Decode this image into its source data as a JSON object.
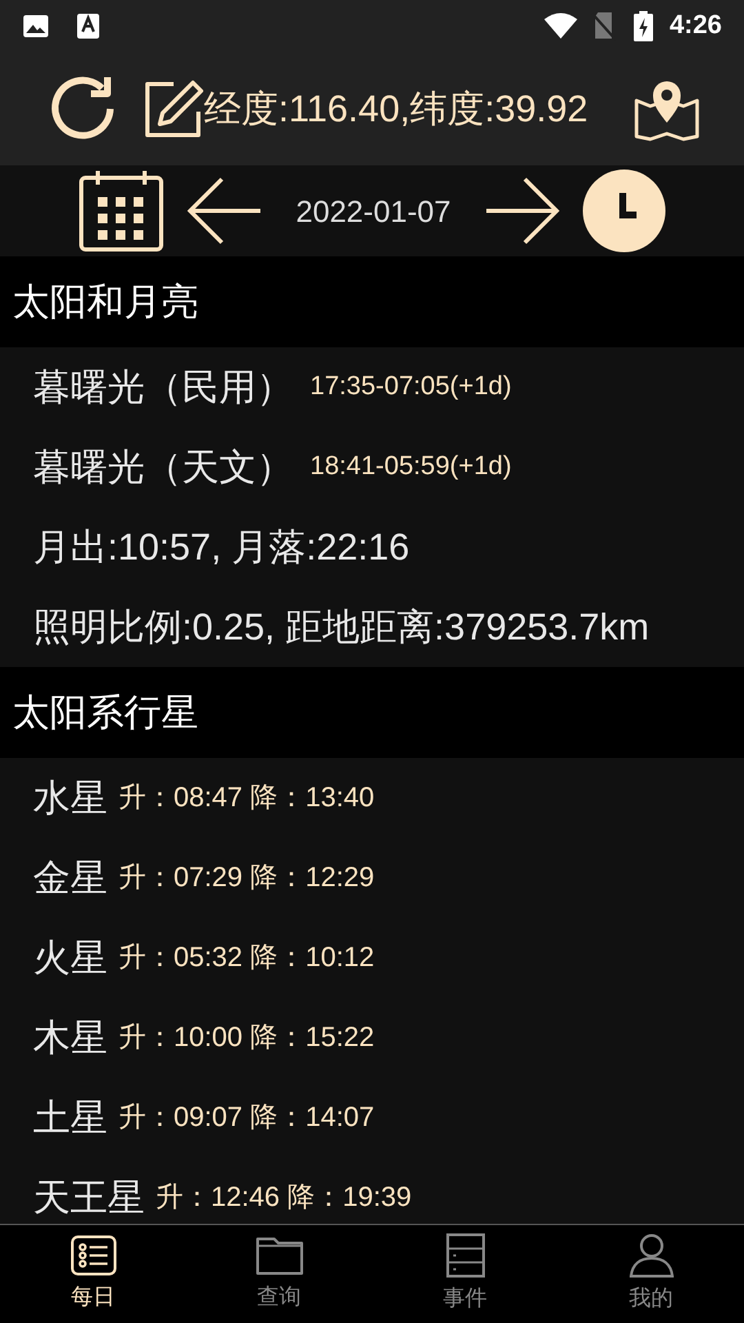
{
  "status_bar": {
    "time": "4:26"
  },
  "header": {
    "location": "经度:116.40,纬度:39.92"
  },
  "date_bar": {
    "date": "2022-01-07"
  },
  "sections": [
    {
      "title": "太阳和月亮",
      "rows": [
        {
          "kind": "pair",
          "label": "暮曙光（民用）",
          "value": "17:35-07:05(+1d)"
        },
        {
          "kind": "pair",
          "label": "暮曙光（天文）",
          "value": "18:41-05:59(+1d)"
        },
        {
          "kind": "line",
          "label": "月出:10:57, 月落:22:16"
        },
        {
          "kind": "line",
          "label": "照明比例:0.25, 距地距离:379253.7km"
        }
      ]
    },
    {
      "title": "太阳系行星",
      "rows": [
        {
          "kind": "planet",
          "label": "水星",
          "value": "升：08:47 降：13:40"
        },
        {
          "kind": "planet",
          "label": "金星",
          "value": "升：07:29 降：12:29"
        },
        {
          "kind": "planet",
          "label": "火星",
          "value": "升：05:32 降：10:12"
        },
        {
          "kind": "planet",
          "label": "木星",
          "value": "升：10:00 降：15:22"
        },
        {
          "kind": "planet",
          "label": "土星",
          "value": "升：09:07 降：14:07"
        },
        {
          "kind": "planet",
          "label": "天王星",
          "value": "升：12:46 降：19:39"
        }
      ]
    }
  ],
  "nav": [
    {
      "label": "每日",
      "selected": true
    },
    {
      "label": "查询",
      "selected": false
    },
    {
      "label": "事件",
      "selected": false
    },
    {
      "label": "我的",
      "selected": false
    }
  ]
}
